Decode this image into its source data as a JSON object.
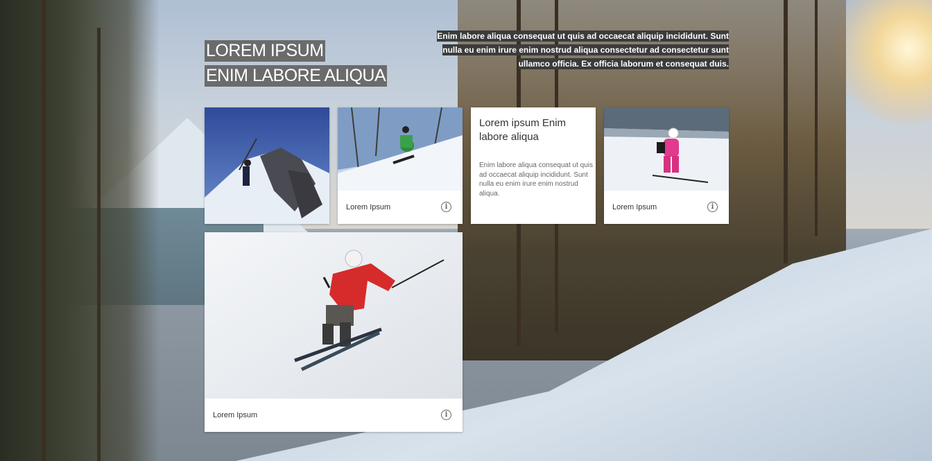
{
  "hero": {
    "title_line1": "LOREM IPSUM",
    "title_line2": "ENIM LABORE ALIQUA",
    "description": "Enim labore aliqua consequat ut quis ad occaecat aliquip incididunt. Sunt nulla eu enim irure enim nostrud aliqua consectetur ad consectetur sunt ullamco officia. Ex officia laborum et consequat duis."
  },
  "cards": {
    "card2_caption": "Lorem Ipsum",
    "text_card_title": "Lorem ipsum Enim labore aliqua",
    "text_card_body": "Enim labore aliqua consequat ut quis ad occaecat aliquip incididunt. Sunt nulla eu enim irure enim nostrud aliqua.",
    "card4_caption": "Lorem Ipsum",
    "card5_caption": "Lorem Ipsum"
  },
  "icons": {
    "info": "info-icon",
    "info_glyph": "i"
  },
  "colors": {
    "title_bg": "#6b6b6b",
    "description_bg": "#3b3b3b",
    "card_bg": "#ffffff"
  }
}
